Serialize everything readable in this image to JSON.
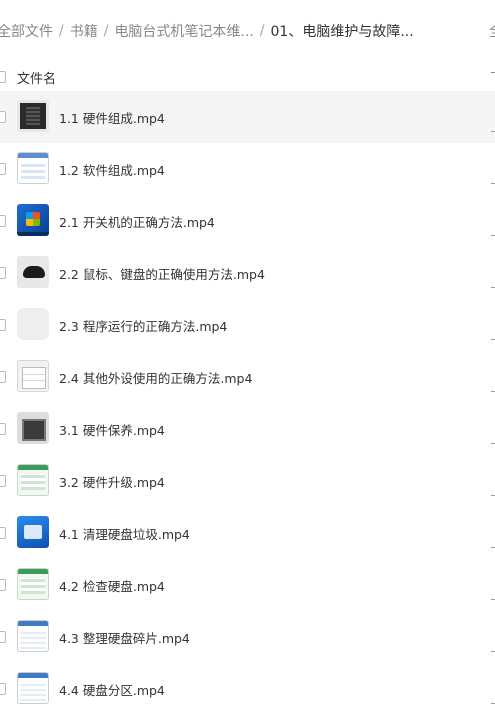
{
  "breadcrumb": {
    "items": [
      "全部文件",
      "书籍",
      "电脑台式机笔记本维...",
      "01、电脑维护与故障..."
    ],
    "separator": "/",
    "right_partial": "全"
  },
  "list": {
    "header_label": "文件名",
    "files": [
      {
        "name": "1.1 硬件组成.mp4",
        "thumb": "hardware-thumbnail"
      },
      {
        "name": "1.2 软件组成.mp4",
        "thumb": "software-window-thumbnail"
      },
      {
        "name": "2.1 开关机的正确方法.mp4",
        "thumb": "windows7-desktop-thumbnail"
      },
      {
        "name": "2.2 鼠标、键盘的正确使用方法.mp4",
        "thumb": "mouse-thumbnail"
      },
      {
        "name": "2.3 程序运行的正确方法.mp4",
        "thumb": "blank-thumbnail"
      },
      {
        "name": "2.4 其他外设使用的正确方法.mp4",
        "thumb": "screenshot-thumbnail"
      },
      {
        "name": "3.1 硬件保养.mp4",
        "thumb": "hardware-care-thumbnail"
      },
      {
        "name": "3.2 硬件升级.mp4",
        "thumb": "upgrade-window-thumbnail"
      },
      {
        "name": "4.1 清理硬盘垃圾.mp4",
        "thumb": "blue-desktop-thumbnail"
      },
      {
        "name": "4.2 检查硬盘.mp4",
        "thumb": "disk-check-thumbnail"
      },
      {
        "name": "4.3 整理硬盘碎片.mp4",
        "thumb": "defrag-thumbnail"
      },
      {
        "name": "4.4 硬盘分区.mp4",
        "thumb": "partition-thumbnail"
      }
    ]
  },
  "colors": {
    "selected_row_bg": "#f5f5f5",
    "text_primary": "#333333",
    "text_secondary": "#888888"
  }
}
